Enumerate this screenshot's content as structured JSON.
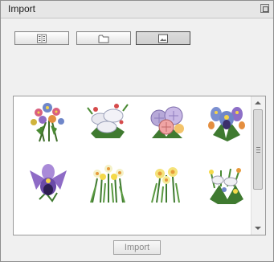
{
  "window": {
    "title": "Import"
  },
  "toolbar": {
    "buttons": [
      {
        "icon": "list-icon",
        "selected": false
      },
      {
        "icon": "folder-icon",
        "selected": false
      },
      {
        "icon": "image-icon",
        "selected": true
      }
    ]
  },
  "gallery": {
    "items": [
      {
        "icon": "flower-bouquet-icon"
      },
      {
        "icon": "white-flowers-icon"
      },
      {
        "icon": "chrysanthemum-icon"
      },
      {
        "icon": "orchid-bouquet-icon"
      },
      {
        "icon": "orchid-icon"
      },
      {
        "icon": "daffodils-icon"
      },
      {
        "icon": "yellow-daffodils-icon"
      },
      {
        "icon": "spring-bouquet-icon"
      }
    ]
  },
  "footer": {
    "import_label": "Import"
  },
  "colors": {
    "panel_bg": "#f0f0f0",
    "border": "#8e8e8e",
    "gallery_bg": "#ffffff"
  }
}
